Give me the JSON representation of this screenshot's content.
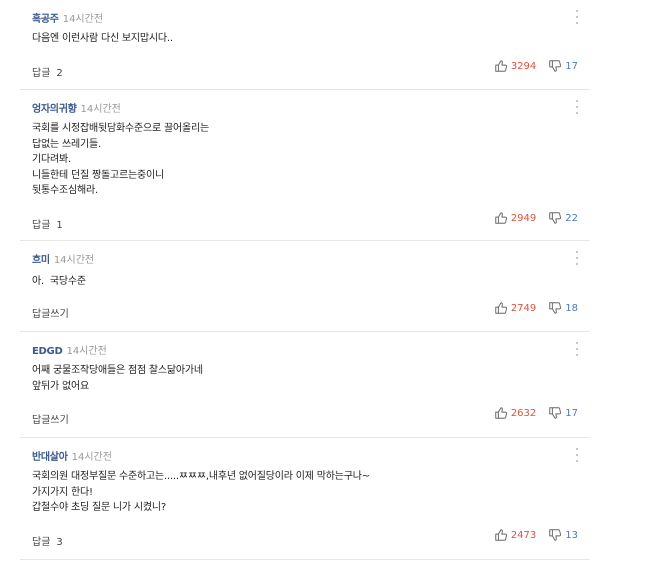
{
  "comments": [
    {
      "author": "흑공주",
      "time": "14시간전",
      "lines": [
        "다음엔 이런사람 다신 보지맙시다.."
      ],
      "reply_label": "답글",
      "reply_count": "2",
      "likes": "3294",
      "dislikes": "17"
    },
    {
      "author": "엉자의귀향",
      "time": "14시간전",
      "lines": [
        "국회를 시정잡배뒷담화수준으로 끌어올리는",
        "답없는 쓰레기들.",
        "기다려봐.",
        "니들한테 던질 짱돌고르는중이니",
        "뒷통수조심해라."
      ],
      "reply_label": "답글",
      "reply_count": "1",
      "likes": "2949",
      "dislikes": "22"
    },
    {
      "author": "흐미",
      "time": "14시간전",
      "lines": [
        "아.  국당수준"
      ],
      "reply_label": "답글쓰기",
      "reply_count": "",
      "likes": "2749",
      "dislikes": "18"
    },
    {
      "author": "EDGD",
      "time": "14시간전",
      "lines": [
        "어째 궁물조작당애들은 점점 찰스닮아가네",
        "앞뒤가 없어요"
      ],
      "reply_label": "답글쓰기",
      "reply_count": "",
      "likes": "2632",
      "dislikes": "17"
    },
    {
      "author": "반대살아",
      "time": "14시간전",
      "lines": [
        "국회의원 대정부질문 수준하고는.....ㅉㅉㅉ,내후년 없어질당이라 이제 막하는구나~",
        "가지가지 한다!",
        "갑철수야 초딩 질문 니가 시켰니?"
      ],
      "reply_label": "답글",
      "reply_count": "3",
      "likes": "2473",
      "dislikes": "13"
    }
  ],
  "colors": {
    "author": "#3a5a8c",
    "like": "#e0503f",
    "dislike": "#4a7ac9"
  },
  "icons": {
    "more": "more-vertical-icon",
    "like": "thumbs-up-icon",
    "dislike": "thumbs-down-icon"
  }
}
